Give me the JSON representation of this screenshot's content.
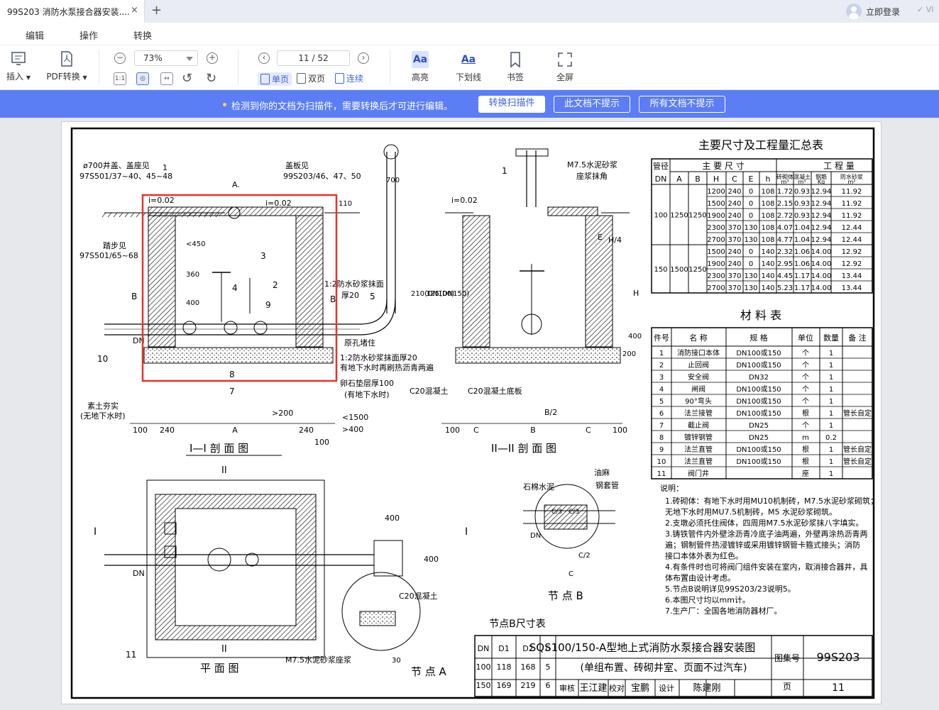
{
  "tab": {
    "title": "99S203 消防水泵接合器安装....",
    "close": "×",
    "new": "+"
  },
  "account": {
    "login": "立即登录",
    "vip": "VI"
  },
  "menu": [
    "编辑",
    "操作",
    "转换"
  ],
  "toolbar": {
    "insert": "插入",
    "pdf_convert": "PDF转换",
    "zoom": "73%",
    "page": "11 / 52",
    "single": "单页",
    "double": "双页",
    "continuous": "连续",
    "highlight": "高亮",
    "underline": "下划线",
    "bookmark": "书签",
    "fullscreen": "全屏",
    "aa": "Aa"
  },
  "notice": {
    "message": "检测到你的文档为扫描件，需要转换后才可进行编辑。",
    "convert": "转换扫描件",
    "dismiss_doc": "此文档不提示",
    "dismiss_all": "所有文档不提示"
  },
  "colors": {
    "accent": "#5b7ef5",
    "selection": "#e8312c"
  },
  "drawing": {
    "summary_title": "主要尺寸及工程量汇总表",
    "dim_headers": [
      "管径",
      "主 要 尺 寸",
      "工 程 量"
    ],
    "dim_sub": [
      "DN",
      "A",
      "B",
      "H",
      "C",
      "E",
      "h",
      "砖砌体",
      "混凝土",
      "钢筋",
      "防水砂浆"
    ],
    "dim_units": [
      "m³",
      "m³",
      "Kg",
      "m²"
    ],
    "group100": {
      "dn": "100",
      "a": "1250",
      "b": "1250"
    },
    "group150": {
      "dn": "150",
      "a": "1500",
      "b": "1250"
    },
    "dim_rows": [
      [
        "1200",
        "240",
        "0",
        "108",
        "1.72",
        "0.93",
        "12.94",
        "11.92"
      ],
      [
        "1500",
        "240",
        "0",
        "108",
        "2.15",
        "0.93",
        "12.94",
        "11.92"
      ],
      [
        "1900",
        "240",
        "0",
        "108",
        "2.72",
        "0.93",
        "12.94",
        "11.92"
      ],
      [
        "2300",
        "370",
        "130",
        "108",
        "4.07",
        "1.04",
        "12.94",
        "12.44"
      ],
      [
        "2700",
        "370",
        "130",
        "108",
        "4.77",
        "1.04",
        "12.94",
        "12.44"
      ],
      [
        "1500",
        "240",
        "0",
        "140",
        "2.32",
        "1.06",
        "14.00",
        "12.92"
      ],
      [
        "1900",
        "240",
        "0",
        "140",
        "2.95",
        "1.06",
        "14.00",
        "12.92"
      ],
      [
        "2300",
        "370",
        "130",
        "140",
        "4.45",
        "1.17",
        "14.00",
        "13.44"
      ],
      [
        "2700",
        "370",
        "130",
        "140",
        "5.23",
        "1.17",
        "14.00",
        "13.44"
      ]
    ],
    "material_title": "材 料 表",
    "mat_headers": [
      "件号",
      "名 称",
      "规 格",
      "单位",
      "数量",
      "备 注"
    ],
    "mat_rows": [
      [
        "1",
        "消防接口本体",
        "DN100或150",
        "个",
        "1",
        ""
      ],
      [
        "2",
        "止回阀",
        "DN100或150",
        "个",
        "1",
        ""
      ],
      [
        "3",
        "安全阀",
        "DN32",
        "个",
        "1",
        ""
      ],
      [
        "4",
        "闸阀",
        "DN100或150",
        "个",
        "1",
        ""
      ],
      [
        "5",
        "90°弯头",
        "DN100或150",
        "个",
        "1",
        ""
      ],
      [
        "6",
        "法兰接管",
        "DN100或150",
        "根",
        "1",
        "管长自定"
      ],
      [
        "7",
        "截止阀",
        "DN25",
        "个",
        "1",
        ""
      ],
      [
        "8",
        "镀锌钢管",
        "DN25",
        "m",
        "0.2",
        ""
      ],
      [
        "9",
        "法兰直管",
        "DN100或150",
        "根",
        "1",
        "管长自定"
      ],
      [
        "10",
        "法兰直管",
        "DN100或150",
        "根",
        "1",
        "管长自定"
      ],
      [
        "11",
        "阀门井",
        "",
        "座",
        "1",
        ""
      ]
    ],
    "notes_title": "说明：",
    "notes": [
      "1.砖砌体：有地下水时用MU10机制砖，M7.5水泥砂浆砌筑；",
      "  无地下水时用MU7.5机制砖，M5 水泥砂浆砌筑。",
      "2.支墩必须托住阀体，四周用M7.5水泥砂浆抹八字填实。",
      "3.铸铁管件内外壁涂沥青冷底子油两遍，外壁再涂热沥青两",
      "  遍；钢制管件热浸镀锌或采用镀锌钢管卡箍式接头；消防",
      "  接口本体外表为红色。",
      "4.有条件时也可将阀门组件安装在室内，取消接合器井，具",
      "  体布置由设计考虑。",
      "5.节点B说明详见99S203/23说明5。",
      "6.本图尺寸均以mm计。",
      "7.生产厂：全国各地消防器材厂。"
    ],
    "title_main": "SQS100/150-A型地上式消防水泵接合器安装图",
    "title_sub": "(单组布置、砖砌井室、页面不过汽车)",
    "atlas_label": "图集号",
    "atlas_no": "99S203",
    "page_label": "页",
    "page_no": "11",
    "sign_labels": [
      "审核",
      "校对",
      "设计"
    ],
    "signatures": [
      "王江建",
      "宝鹏",
      "陈建刚"
    ],
    "nodeb_title": "节点B尺寸表",
    "nodeb_headers": [
      "DN",
      "D1",
      "D2",
      "δ"
    ],
    "nodeb_rows": [
      [
        "100",
        "118",
        "168",
        "5"
      ],
      [
        "150",
        "169",
        "219",
        "6"
      ]
    ],
    "section1": "I—I 剖 面 图",
    "section2": "II—II 剖 面 图",
    "plan": "平 面 图",
    "node_a": "节 点 A",
    "node_b": "节 点 B",
    "labels": {
      "manhole": "ø700井盖、盖座见",
      "manhole_ref": "97S501/37~40、45~48",
      "cover": "盖板见",
      "cover_ref": "99S203/46、47、50",
      "step": "踏步见",
      "step_ref": "97S501/65~68",
      "slope": "i=0.02",
      "mortar": "1:2防水砂浆抹面",
      "mortar_t": "厚20",
      "plug": "原孔堵住",
      "mortar2": "1:2防水砂浆抹面厚20",
      "asphalt": "有地下水时再刷热沥青两遍",
      "gravel": "卵石垫层厚100",
      "gravel_cond": "(有地下水时)",
      "soil": "素土夯实",
      "soil_cond": "(无地下水时)",
      "c20": "C20混凝土",
      "c20slab": "C20混凝土底板",
      "m75": "M7.5水泥砂浆",
      "m75b": "座浆抹角",
      "m75seat": "M7.5水泥砂浆座浆",
      "asbestos": "石棉水泥",
      "hemp": "油麻",
      "sleeve": "钢套管",
      "dn": "DN"
    },
    "dims": {
      "a": "A",
      "b": "B",
      "c": "C",
      "h": "H",
      "h4": "H/4",
      "e": "E",
      "b2": "B/2",
      "c2": "C/2",
      "c3": "C/3",
      "d100": "100",
      "d240": "240",
      "d200": ">200",
      "d1500": "<1500",
      "d400": ">400",
      "d700": "700",
      "d110": "110",
      "d450": "<450",
      "d360": "360",
      "d400b": "400",
      "d200b": "200",
      "d210": "210(DN100)",
      "d325": "325(DN150)",
      "d30": "30"
    },
    "part_nos": [
      "1",
      "2",
      "3",
      "4",
      "5",
      "7",
      "8",
      "9",
      "10",
      "11"
    ],
    "section_marks": [
      "A",
      "B",
      "I",
      "II"
    ]
  }
}
